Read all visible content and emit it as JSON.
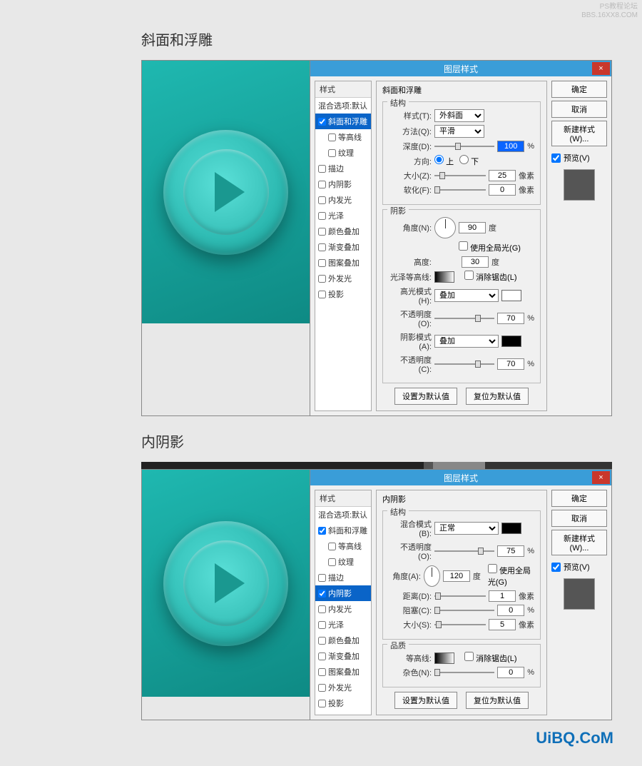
{
  "watermark_top": {
    "line1": "PS教程论坛",
    "line2": "BBS.16XX8.COM"
  },
  "watermark_bottom": "UiBQ.CoM",
  "section1_title": "斜面和浮雕",
  "section2_title": "内阴影",
  "dialog_title": "图层样式",
  "close_x": "×",
  "styles_header": "样式",
  "blend_default": "混合选项:默认",
  "style_items": {
    "bevel": "斜面和浮雕",
    "contour": "等高线",
    "texture": "纹理",
    "stroke": "描边",
    "inner_shadow": "内阴影",
    "inner_glow": "内发光",
    "satin": "光泽",
    "color_overlay": "颜色叠加",
    "gradient_overlay": "渐变叠加",
    "pattern_overlay": "图案叠加",
    "outer_glow": "外发光",
    "drop_shadow": "投影"
  },
  "bevel": {
    "group_title": "斜面和浮雕",
    "structure": "结构",
    "style_lbl": "样式(T):",
    "style_val": "外斜面",
    "tech_lbl": "方法(Q):",
    "tech_val": "平滑",
    "depth_lbl": "深度(D):",
    "depth_val": "100",
    "pct": "%",
    "dir_lbl": "方向:",
    "up": "上",
    "down": "下",
    "size_lbl": "大小(Z):",
    "size_val": "25",
    "px": "像素",
    "soften_lbl": "软化(F):",
    "soften_val": "0",
    "shading": "阴影",
    "angle_lbl": "角度(N):",
    "angle_val": "90",
    "deg": "度",
    "global_light": "使用全局光(G)",
    "alt_lbl": "高度:",
    "alt_val": "30",
    "gloss_lbl": "光泽等高线:",
    "anti": "消除锯齿(L)",
    "hmode_lbl": "高光模式(H):",
    "hmode_val": "叠加",
    "hop_lbl": "不透明度(O):",
    "hop_val": "70",
    "smode_lbl": "阴影模式(A):",
    "smode_val": "叠加",
    "sop_lbl": "不透明度(C):",
    "sop_val": "70"
  },
  "inner": {
    "group_title": "内阴影",
    "structure": "结构",
    "blend_lbl": "混合模式(B):",
    "blend_val": "正常",
    "op_lbl": "不透明度(O):",
    "op_val": "75",
    "pct": "%",
    "angle_lbl": "角度(A):",
    "angle_val": "120",
    "deg": "度",
    "global_light": "使用全局光(G)",
    "dist_lbl": "距离(D):",
    "dist_val": "1",
    "px": "像素",
    "choke_lbl": "阻塞(C):",
    "choke_val": "0",
    "size_lbl": "大小(S):",
    "size_val": "5",
    "quality": "品质",
    "contour_lbl": "等高线:",
    "anti": "消除锯齿(L)",
    "noise_lbl": "杂色(N):",
    "noise_val": "0"
  },
  "buttons": {
    "ok": "确定",
    "cancel": "取消",
    "new_style": "新建样式(W)...",
    "preview": "预览(V)",
    "default": "设置为默认值",
    "reset": "复位为默认值"
  }
}
